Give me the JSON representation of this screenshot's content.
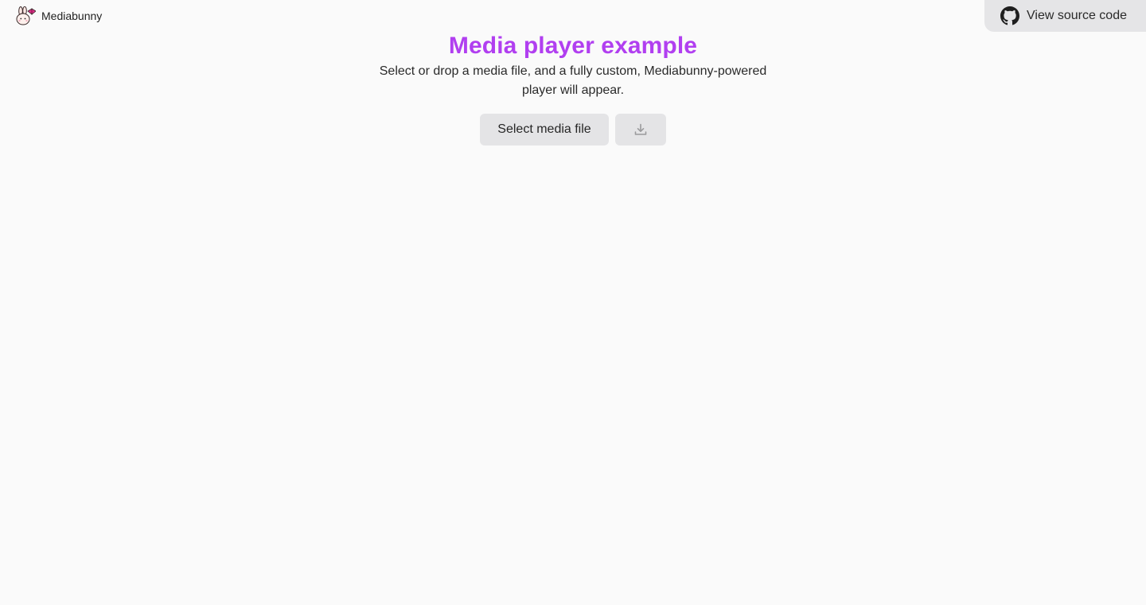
{
  "header": {
    "brand_name": "Mediabunny",
    "logo_icon": "bunny-logo-icon",
    "source_button_label": "View source code",
    "source_button_icon": "github-icon"
  },
  "main": {
    "title": "Media player example",
    "subtitle": "Select or drop a media file, and a fully custom, Mediabunny-powered player will appear.",
    "select_button_label": "Select media file",
    "download_button_icon": "download-icon"
  },
  "colors": {
    "accent": "#b13ff0",
    "background": "#fafafa",
    "button_background": "#e4e4e6"
  }
}
